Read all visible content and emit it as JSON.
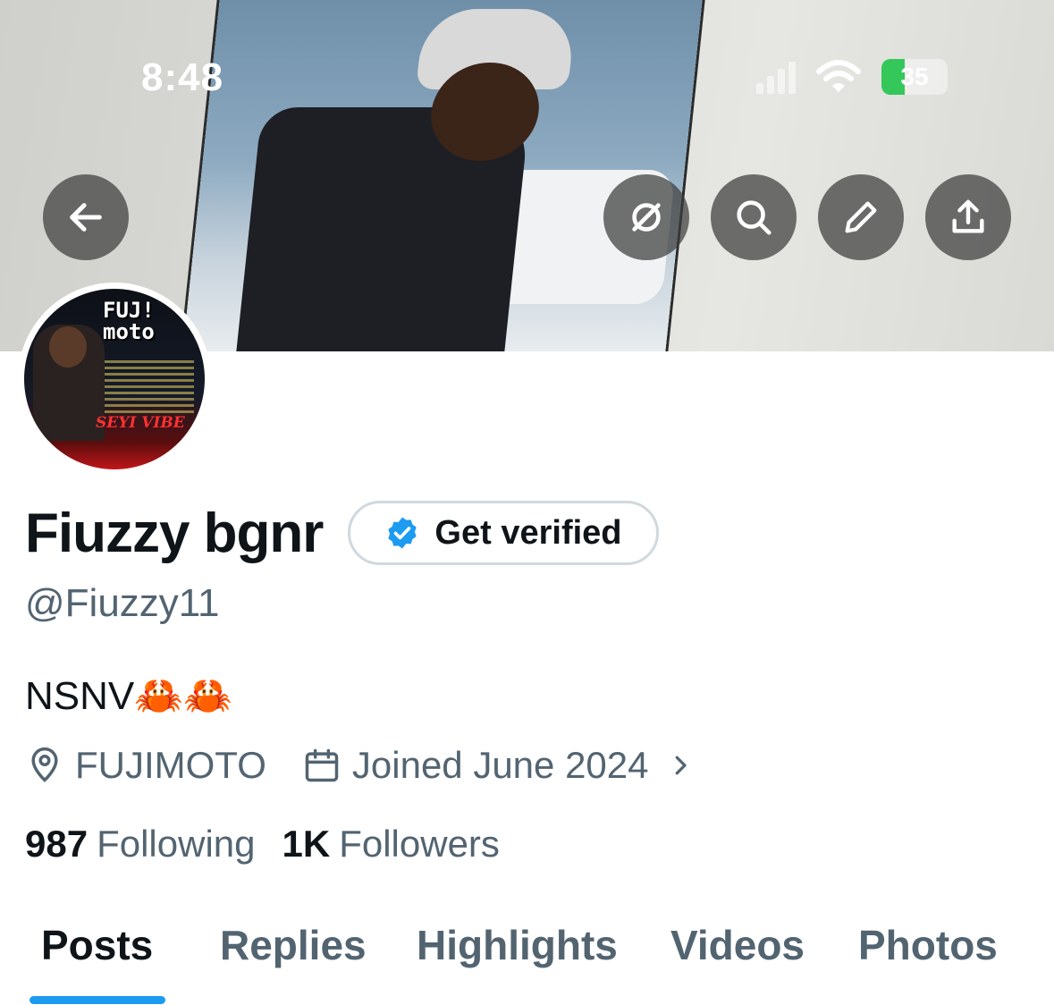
{
  "status_bar": {
    "time": "8:48",
    "battery_percent": "35"
  },
  "header": {
    "back_icon": "arrow-left-icon",
    "actions": [
      "grok-icon",
      "search-icon",
      "pencil-icon",
      "share-icon"
    ]
  },
  "profile": {
    "display_name": "Fiuzzy bgnr",
    "verify_label": "Get verified",
    "handle": "@Fiuzzy11",
    "bio": "NSNV🦀🦀",
    "location": "FUJIMOTO",
    "joined": "Joined June 2024",
    "avatar_text": {
      "logo": "FUJ!\nmoto",
      "caption": "SEYI VIBE"
    }
  },
  "stats": {
    "following_count": "987",
    "following_label": "Following",
    "followers_count": "1K",
    "followers_label": "Followers"
  },
  "tabs": [
    "Posts",
    "Replies",
    "Highlights",
    "Videos",
    "Photos"
  ],
  "colors": {
    "accent": "#1d9bf0",
    "secondary_text": "#536471",
    "primary_text": "#0f1419"
  }
}
